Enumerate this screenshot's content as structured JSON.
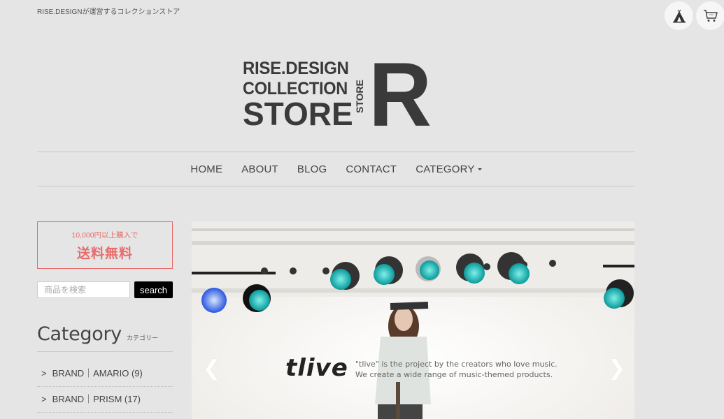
{
  "header": {
    "tagline": "RISE.DESIGNが運営するコレクションストア",
    "icons": [
      {
        "name": "tent-icon",
        "label": "teepee"
      },
      {
        "name": "cart-icon",
        "label": "cart"
      }
    ],
    "logo": {
      "line1": "RISE.DESIGN",
      "line2": "COLLECTION",
      "line3": "STORE",
      "vertical": "STORE",
      "letter": "R"
    }
  },
  "nav": {
    "items": [
      {
        "label": "HOME"
      },
      {
        "label": "ABOUT"
      },
      {
        "label": "BLOG"
      },
      {
        "label": "CONTACT"
      },
      {
        "label": "CATEGORY",
        "has_dropdown": true
      }
    ]
  },
  "sidebar": {
    "shipping": {
      "condition": "10,000円以上購入で",
      "headline": "送料無料",
      "color": "#e86b6b"
    },
    "search": {
      "placeholder": "商品を検索",
      "value": "",
      "button_label": "search"
    },
    "category": {
      "title": "Category",
      "subtitle": "カテゴリー",
      "items": [
        {
          "arrow": ">",
          "label": "BRAND｜AMARIO (9)"
        },
        {
          "arrow": ">",
          "label": "BRAND｜PRISM (17)"
        }
      ]
    }
  },
  "slider": {
    "prev_glyph": "❮",
    "next_glyph": "❯",
    "brand": "tlive",
    "copy_line1": "\"tlive\" is the project by the creators who love music.",
    "copy_line2": "We create a wide range of music-themed products."
  }
}
